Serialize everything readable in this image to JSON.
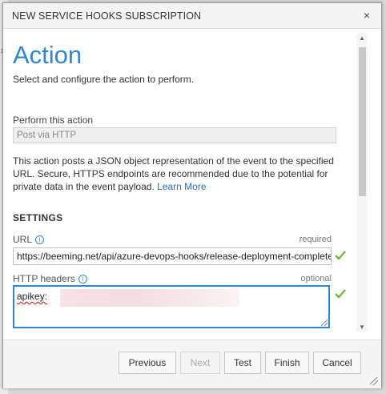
{
  "dialog": {
    "title": "NEW SERVICE HOOKS SUBSCRIPTION",
    "close_symbol": "×"
  },
  "page": {
    "heading": "Action",
    "description": "Select and configure the action to perform."
  },
  "action": {
    "label": "Perform this action",
    "value": "Post via HTTP",
    "explanation": "This action posts a JSON object representation of the event to the specified URL. Secure, HTTPS endpoints are recommended due to the potential for private data in the event payload.",
    "learn_more": "Learn More"
  },
  "settings": {
    "heading": "SETTINGS",
    "url": {
      "label": "URL",
      "hint": "required",
      "value": "https://beeming.net/api/azure-devops-hooks/release-deployment-complete",
      "valid": true
    },
    "headers": {
      "label": "HTTP headers",
      "hint": "optional",
      "value": "apikey:",
      "valid": true
    }
  },
  "icons": {
    "info": "info-icon",
    "check": "checkmark-icon",
    "check_color": "#7cb342",
    "accent": "#2b88d8"
  },
  "buttons": {
    "previous": "Previous",
    "next": "Next",
    "test": "Test",
    "finish": "Finish",
    "cancel": "Cancel"
  }
}
